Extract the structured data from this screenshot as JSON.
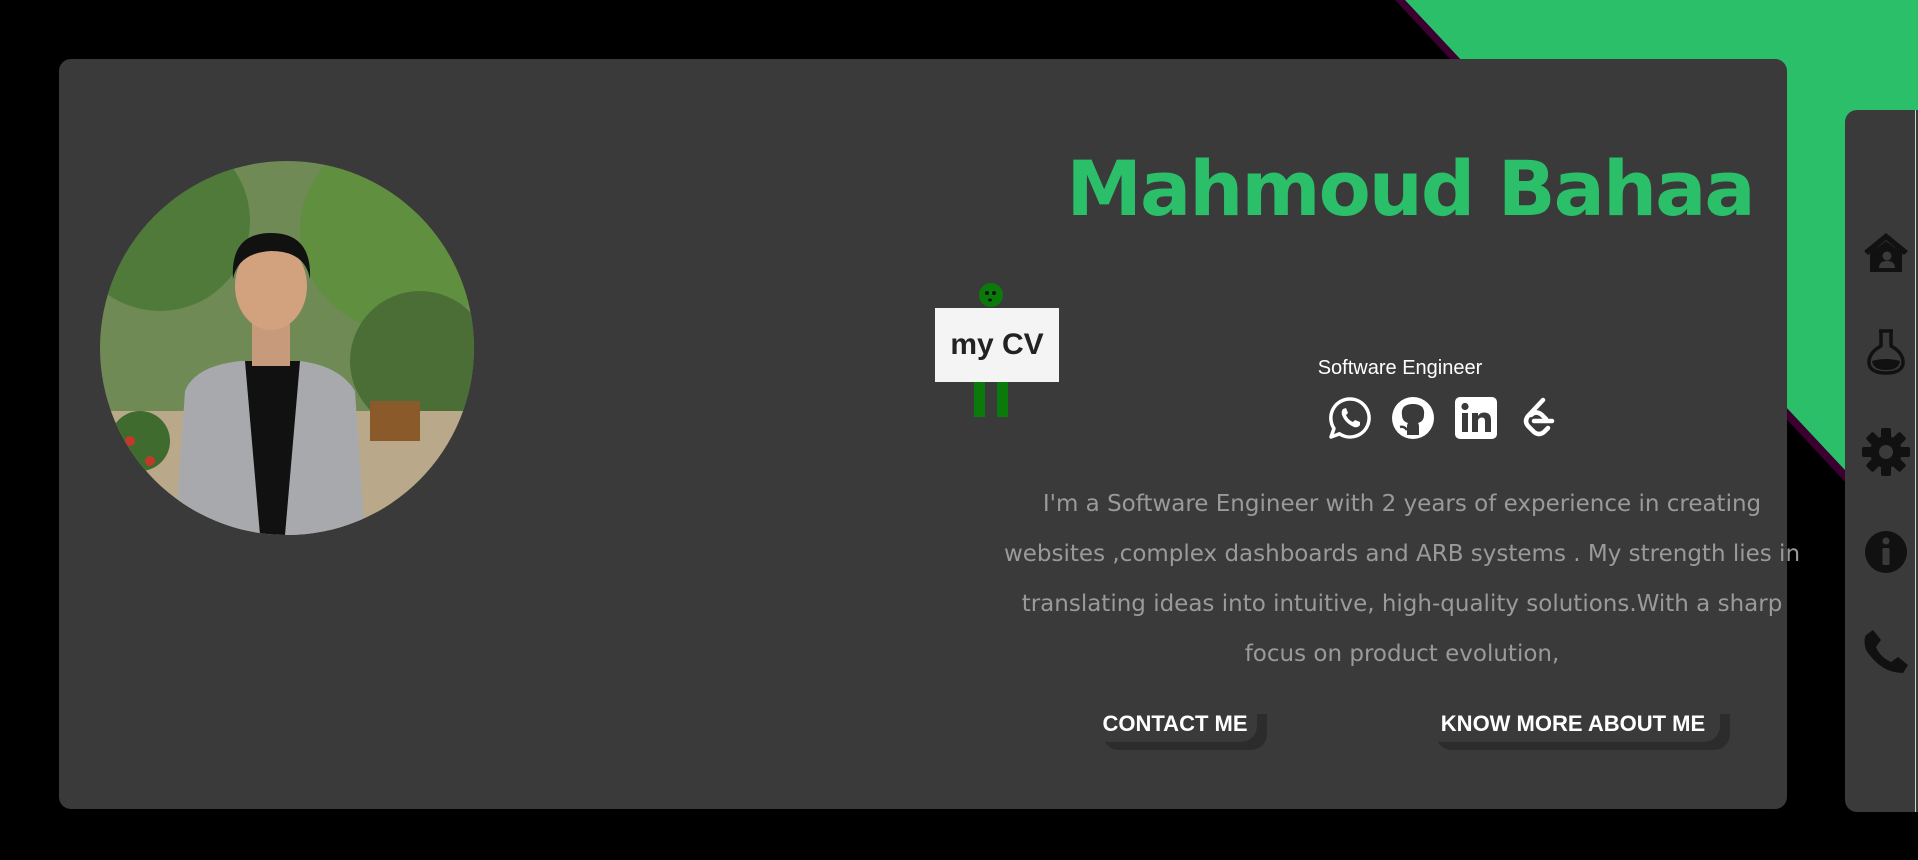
{
  "colors": {
    "accent": "#2bbf6a",
    "background": "#000000",
    "card": "#3a3a3a",
    "bio_text": "#9a9a9a"
  },
  "hero": {
    "name": "Mahmoud Bahaa",
    "subtitle": "Software Engineer",
    "bio": "I'm a Software Engineer with 2 years of experience in creating websites ,complex dashboards and ARB systems . My strength lies in translating ideas into intuitive, high-quality solutions.With a sharp focus on product evolution,",
    "cv_label": "my CV",
    "contact_label": "CONTACT ME",
    "more_label": "KNOW MORE ABOUT ME"
  },
  "socials": [
    {
      "icon": "whatsapp-icon"
    },
    {
      "icon": "github-icon"
    },
    {
      "icon": "linkedin-icon"
    },
    {
      "icon": "leetcode-icon"
    }
  ],
  "nav": [
    {
      "icon": "home-icon"
    },
    {
      "icon": "flask-icon"
    },
    {
      "icon": "gear-icon"
    },
    {
      "icon": "info-icon"
    },
    {
      "icon": "phone-icon"
    }
  ]
}
